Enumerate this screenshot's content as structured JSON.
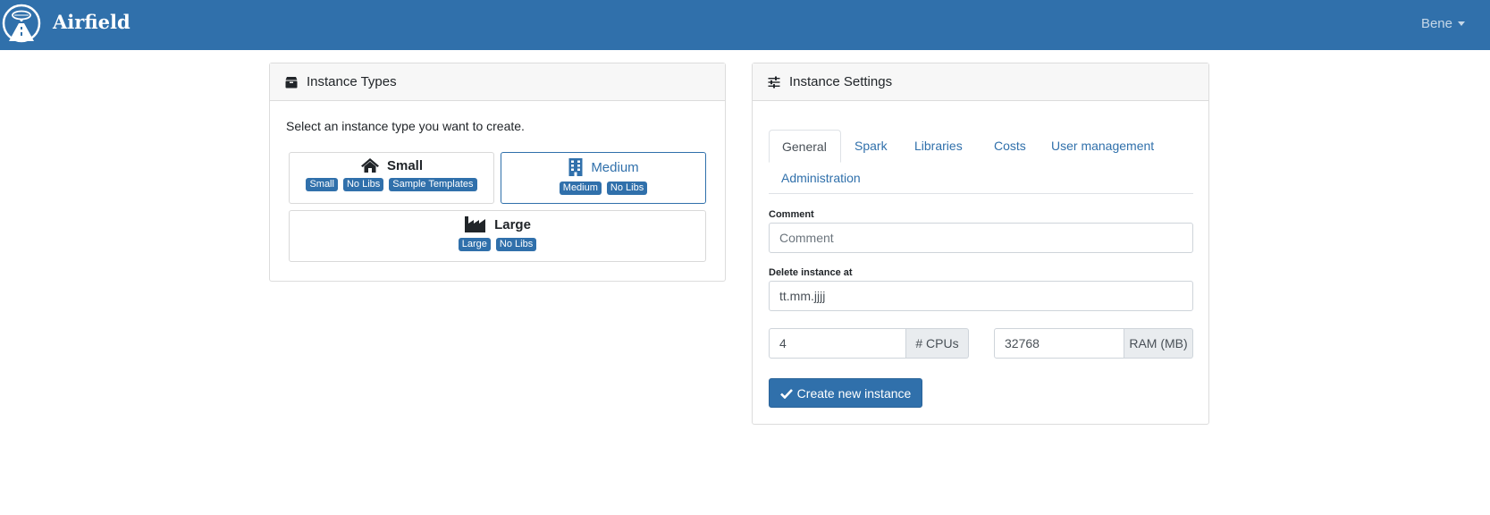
{
  "navbar": {
    "title": "Airfield",
    "user_label": "Bene"
  },
  "types_card": {
    "title": "Instance Types",
    "intro": "Select an instance type you want to create.",
    "types": [
      {
        "name": "Small",
        "icon": "home-icon",
        "badges": [
          "Small",
          "No Libs",
          "Sample Templates"
        ],
        "selected": false
      },
      {
        "name": "Medium",
        "icon": "building-icon",
        "badges": [
          "Medium",
          "No Libs"
        ],
        "selected": true
      },
      {
        "name": "Large",
        "icon": "industry-icon",
        "badges": [
          "Large",
          "No Libs"
        ],
        "selected": false
      }
    ]
  },
  "settings_card": {
    "title": "Instance Settings",
    "tabs": [
      "General",
      "Spark",
      "Libraries",
      "Costs",
      "User management",
      "Administration"
    ],
    "active_tab": "General",
    "comment": {
      "label": "Comment",
      "placeholder": "Comment",
      "value": ""
    },
    "delete_at": {
      "label": "Delete instance at",
      "value": "tt.mm.jjjj"
    },
    "cpus": {
      "value": "4",
      "addon": "# CPUs"
    },
    "ram": {
      "value": "32768",
      "addon": "RAM (MB)"
    },
    "create_button": "Create new instance"
  },
  "colors": {
    "primary": "#3070ab",
    "navbar": "#3070ab",
    "card_header_bg": "#f7f7f7"
  }
}
